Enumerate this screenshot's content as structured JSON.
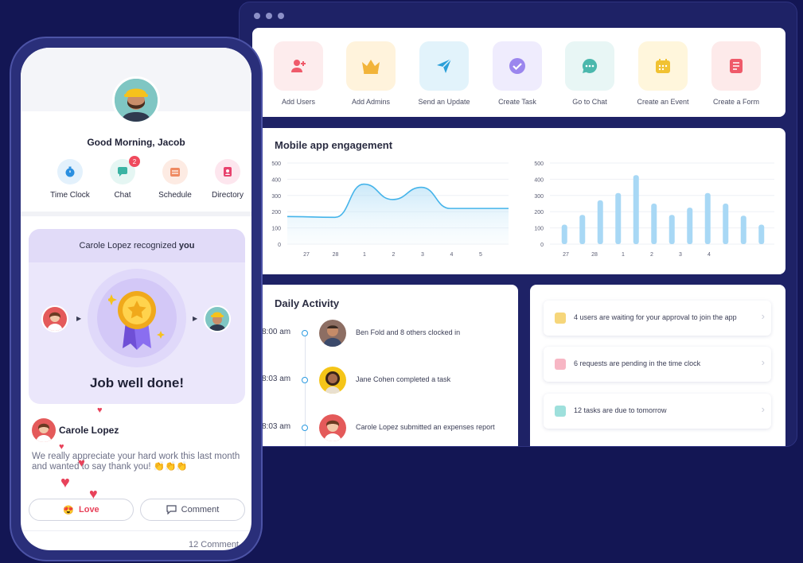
{
  "quick_actions": [
    {
      "label": "Add Users",
      "icon": "add-user-icon",
      "bg": "#fdeced",
      "color": "#ef5a6a"
    },
    {
      "label": "Add Admins",
      "icon": "crown-icon",
      "bg": "#fff3dc",
      "color": "#f2b43a"
    },
    {
      "label": "Send an Update",
      "icon": "send-icon",
      "bg": "#e2f3fb",
      "color": "#2a9fd8"
    },
    {
      "label": "Create Task",
      "icon": "check-circle-icon",
      "bg": "#efecfd",
      "color": "#9b86ee"
    },
    {
      "label": "Go to Chat",
      "icon": "chat-bubble-icon",
      "bg": "#e8f6f5",
      "color": "#4bb8ad"
    },
    {
      "label": "Create an Event",
      "icon": "calendar-icon",
      "bg": "#fff6dc",
      "color": "#f1c232"
    },
    {
      "label": "Create a Form",
      "icon": "form-icon",
      "bg": "#fdeaea",
      "color": "#ef5a6a"
    }
  ],
  "engagement": {
    "title": "Mobile app engagement"
  },
  "chart_data": [
    {
      "type": "area",
      "x": [
        "27",
        "28",
        "1",
        "2",
        "3",
        "4",
        "5"
      ],
      "values": [
        170,
        165,
        370,
        275,
        350,
        220,
        220
      ],
      "ylim": [
        0,
        500
      ],
      "yticks": [
        0,
        100,
        200,
        300,
        400,
        500
      ],
      "grid": true
    },
    {
      "type": "bar",
      "categories": [
        "27",
        "28",
        "1",
        "2",
        "3",
        "4"
      ],
      "values": [
        120,
        180,
        270,
        315,
        425,
        250,
        180,
        225,
        315,
        250,
        175,
        120
      ],
      "ylim": [
        0,
        500
      ],
      "yticks": [
        0,
        100,
        200,
        300,
        400,
        500
      ],
      "grid": true
    }
  ],
  "daily": {
    "title": "Daily Activity",
    "items": [
      {
        "time": "8:00 am",
        "text": "Ben Fold and 8 others clocked in"
      },
      {
        "time": "8:03 am",
        "text": "Jane Cohen completed a task"
      },
      {
        "time": "8:03 am",
        "text": "Carole Lopez submitted an expenses report"
      }
    ]
  },
  "pending": [
    {
      "text": "4 users are waiting for your approval to join the app",
      "color": "#f6d67a"
    },
    {
      "text": "6 requests are pending in the time clock",
      "color": "#f7b6c4"
    },
    {
      "text": "12 tasks are due to tomorrow",
      "color": "#9ee0dc"
    }
  ],
  "phone": {
    "greeting": "Good Morning, Jacob",
    "shortcuts": [
      {
        "label": "Time Clock",
        "icon": "stopwatch-icon",
        "bg": "#e3f1fc",
        "color": "#2a8fe0"
      },
      {
        "label": "Chat",
        "icon": "chat-icon",
        "bg": "#e5f6f3",
        "color": "#3ab3a3",
        "badge": "2"
      },
      {
        "label": "Schedule",
        "icon": "schedule-icon",
        "bg": "#fdebe3",
        "color": "#ef8a62"
      },
      {
        "label": "Directory",
        "icon": "directory-icon",
        "bg": "#fde6ee",
        "color": "#e8426e"
      }
    ],
    "recognition_prefix": "Carole Lopez recognized",
    "recognition_target": "you",
    "recognition_title": "Job well done!",
    "post_author": "Carole Lopez",
    "post_text": "We really appreciate your hard work this last month and wanted to say thank you! 👏👏👏",
    "love_label": "Love",
    "comment_label": "Comment",
    "comment_count": "12 Comment"
  }
}
